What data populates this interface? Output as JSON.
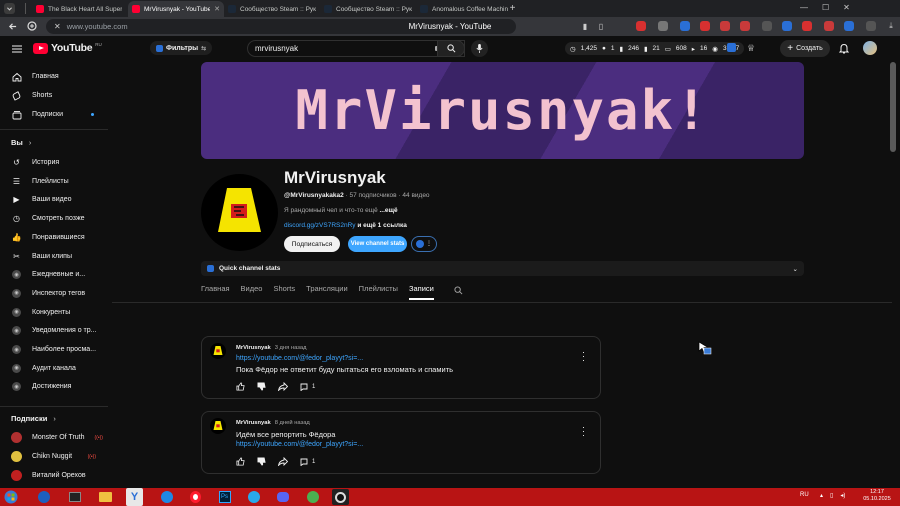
{
  "browser": {
    "tabs": [
      {
        "title": "The Black Heart All Super",
        "favicon_color": "#ff0033",
        "active": false
      },
      {
        "title": "MrVirusnyak - YouTube",
        "favicon_color": "#ff0033",
        "active": true
      },
      {
        "title": "Сообщество Steam :: Руко",
        "favicon_color": "#1b2838",
        "active": false
      },
      {
        "title": "Сообщество Steam :: Руко",
        "favicon_color": "#1b2838",
        "active": false
      },
      {
        "title": "Anomalous Coffee Machine",
        "favicon_color": "#1b2838",
        "active": false
      }
    ],
    "url": "www.youtube.com",
    "page_title": "MrVirusnyak - YouTube",
    "accent": "#ff0033"
  },
  "yt": {
    "logo_text": "YouTube",
    "logo_region": "RU",
    "filter_label": "Фильтры",
    "search_value": "mrvirusnyak",
    "stats": [
      "1,425",
      "1",
      "246",
      "21",
      "608",
      "16",
      "3,387"
    ],
    "create_label": "Создать"
  },
  "sidebar": {
    "main": [
      {
        "label": "Главная",
        "icon": "home-icon"
      },
      {
        "label": "Shorts",
        "icon": "shorts-icon"
      },
      {
        "label": "Подписки",
        "icon": "subscriptions-icon"
      }
    ],
    "you_header": "Вы",
    "you": [
      {
        "label": "История",
        "icon": "history-icon"
      },
      {
        "label": "Плейлисты",
        "icon": "playlists-icon"
      },
      {
        "label": "Ваши видео",
        "icon": "your-videos-icon"
      },
      {
        "label": "Смотреть позже",
        "icon": "watch-later-icon"
      },
      {
        "label": "Понравившиеся",
        "icon": "like-icon"
      },
      {
        "label": "Ваши клипы",
        "icon": "clips-icon"
      },
      {
        "label": "Ежедневные и...",
        "icon": "extension-icon"
      },
      {
        "label": "Инспектор тегов",
        "icon": "extension-icon"
      },
      {
        "label": "Конкуренты",
        "icon": "extension-icon"
      },
      {
        "label": "Уведомления о тр...",
        "icon": "extension-icon"
      },
      {
        "label": "Наиболее просма...",
        "icon": "extension-icon"
      },
      {
        "label": "Аудит канала",
        "icon": "extension-icon"
      },
      {
        "label": "Достижения",
        "icon": "extension-icon"
      }
    ],
    "subs_header": "Подписки",
    "subs": [
      {
        "label": "Monster Of Truth",
        "avatar_color": "#b03030",
        "live": "((•))"
      },
      {
        "label": "Chikn Nuggit",
        "avatar_color": "#e0c040",
        "live": "((•))"
      },
      {
        "label": "Виталий Орехов",
        "avatar_color": "#c02020",
        "live": ""
      }
    ]
  },
  "channel": {
    "banner_text": "MrVirusnyak!",
    "name": "MrVirusnyak",
    "handle": "@MrVirusnyakaka2",
    "meta_rest": " · 57 подписчиков · 44 видео",
    "description": "Я рандомный чел и что-то ещё ",
    "desc_more": "...ещё",
    "link": "discord.gg/zVS7RS2nRy",
    "link_more": " и ещё 1 ссылка",
    "subscribe_label": "Подписаться",
    "stats_button": "View channel stats",
    "quick_stats": "Quick channel stats",
    "tabs": [
      "Главная",
      "Видео",
      "Shorts",
      "Трансляции",
      "Плейлисты",
      "Записи"
    ],
    "active_tab": "Записи"
  },
  "posts": [
    {
      "author": "MrVirusnyak",
      "date": "3 дня назад",
      "link": "https://youtube.com/@fedor_playyt?si=...",
      "text": "Пока Фёдор не ответит буду пытаться его взломать и спамить",
      "comments": "1"
    },
    {
      "author": "MrVirusnyak",
      "date": "8 дней назад",
      "text": "Идём все репортить Фёдора",
      "link": "https://youtube.com/@fedor_playyt?si=...",
      "comments": "1"
    }
  ],
  "taskbar": {
    "lang": "RU",
    "time": "12:17",
    "date": "05.10.2025",
    "bg": "#b81414"
  }
}
